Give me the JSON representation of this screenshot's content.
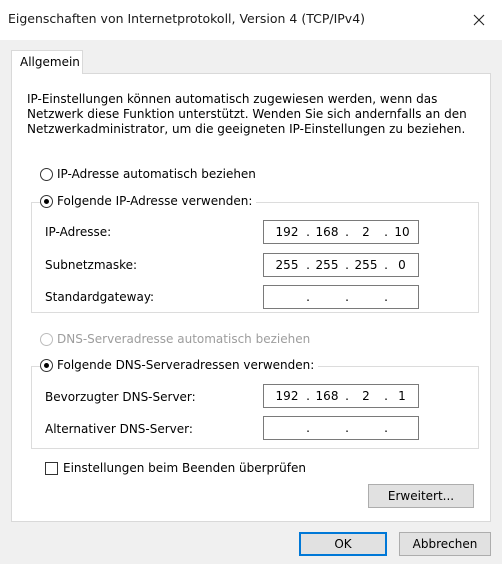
{
  "window": {
    "title": "Eigenschaften von Internetprotokoll, Version 4 (TCP/IPv4)",
    "close_icon": "close-icon"
  },
  "tabs": [
    {
      "label": "Allgemein",
      "selected": true
    }
  ],
  "general": {
    "intro": "IP-Einstellungen können automatisch zugewiesen werden, wenn das Netzwerk diese Funktion unterstützt. Wenden Sie sich andernfalls an den Netzwerkadministrator, um die geeigneten IP-Einstellungen zu beziehen.",
    "ip_auto_label": "IP-Adresse automatisch beziehen",
    "ip_manual_label": "Folgende IP-Adresse verwenden:",
    "ip_mode": "manual",
    "ip_address": {
      "label": "IP-Adresse:",
      "octets": [
        "192",
        "168",
        "2",
        "10"
      ]
    },
    "subnet_mask": {
      "label": "Subnetzmaske:",
      "octets": [
        "255",
        "255",
        "255",
        "0"
      ]
    },
    "gateway": {
      "label": "Standardgateway:",
      "octets": [
        "",
        "",
        "",
        ""
      ]
    },
    "dns_auto_label": "DNS-Serveradresse automatisch beziehen",
    "dns_manual_label": "Folgende DNS-Serveradressen verwenden:",
    "dns_mode": "manual",
    "dns_preferred": {
      "label": "Bevorzugter DNS-Server:",
      "octets": [
        "192",
        "168",
        "2",
        "1"
      ]
    },
    "dns_alternate": {
      "label": "Alternativer DNS-Server:",
      "octets": [
        "",
        "",
        "",
        ""
      ]
    },
    "validate_label": "Einstellungen beim Beenden überprüfen",
    "validate_checked": false,
    "advanced_label": "Erweitert..."
  },
  "footer": {
    "ok_label": "OK",
    "cancel_label": "Abbrechen"
  },
  "colors": {
    "accent": "#0078d7",
    "disabled_text": "#9d9d9d"
  }
}
